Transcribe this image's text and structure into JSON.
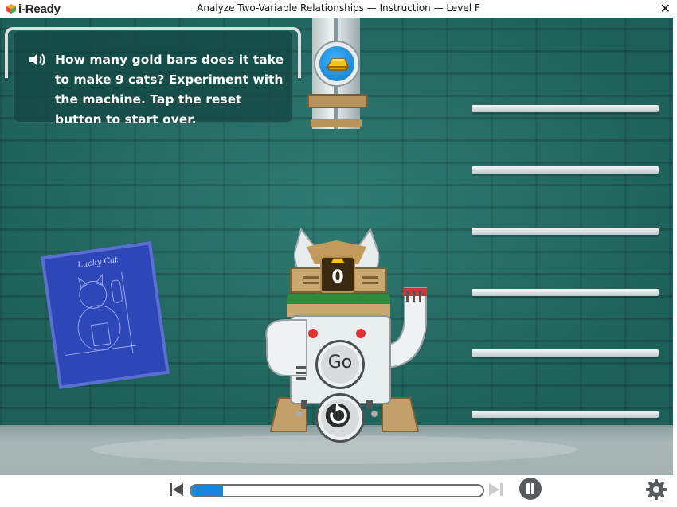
{
  "app": {
    "logo_text": "i-Ready"
  },
  "window": {
    "title": "Analyze Two-Variable Relationships — Instruction — Level F",
    "close_glyph": "✕"
  },
  "prompt": {
    "text": "How many gold bars does it take to make 9 cats? Experiment with the machine. Tap the reset button to start over.",
    "icon": "speaker-icon"
  },
  "machine": {
    "counter_value": "0",
    "go_label": "Go",
    "input_icon": "gold-bar-icon",
    "reset_icon": "reset-arrow-icon"
  },
  "blueprint": {
    "title": "Lucky Cat"
  },
  "shelves": {
    "count": 6
  },
  "player": {
    "progress": 0.11,
    "icons": [
      "skip-back-icon",
      "skip-forward-icon",
      "pause-icon",
      "gear-icon"
    ]
  },
  "colors": {
    "wall": "#24746c",
    "progress_fill": "#1a86d6",
    "prompt_bg": "#14463f"
  }
}
